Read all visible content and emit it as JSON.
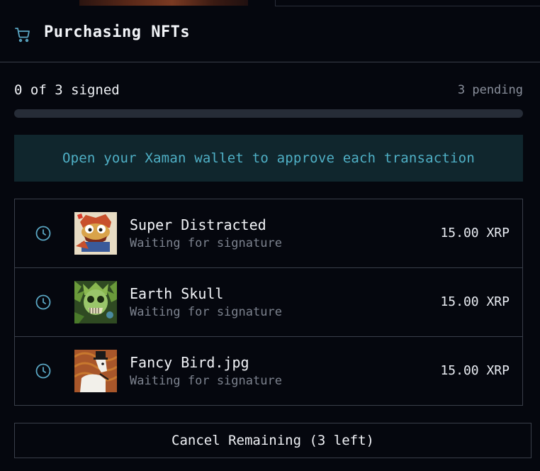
{
  "header": {
    "title": "Purchasing NFTs",
    "icon": "cart-icon"
  },
  "progress": {
    "signed_label": "0 of 3 signed",
    "pending_label": "3 pending",
    "fraction": 0
  },
  "banner": {
    "text": "Open your Xaman wallet to approve each transaction"
  },
  "transactions": [
    {
      "name": "Super Distracted",
      "status": "Waiting for signature",
      "price": "15.00 XRP",
      "icon": "clock-icon"
    },
    {
      "name": "Earth Skull",
      "status": "Waiting for signature",
      "price": "15.00 XRP",
      "icon": "clock-icon"
    },
    {
      "name": "Fancy Bird.jpg",
      "status": "Waiting for signature",
      "price": "15.00 XRP",
      "icon": "clock-icon"
    }
  ],
  "cancel_button": {
    "label": "Cancel Remaining (3 left)"
  },
  "colors": {
    "background": "#05070e",
    "accent": "#4fb0c6",
    "banner_bg": "#10262d",
    "border": "#3a3f4a",
    "muted_text": "#7c828e"
  }
}
